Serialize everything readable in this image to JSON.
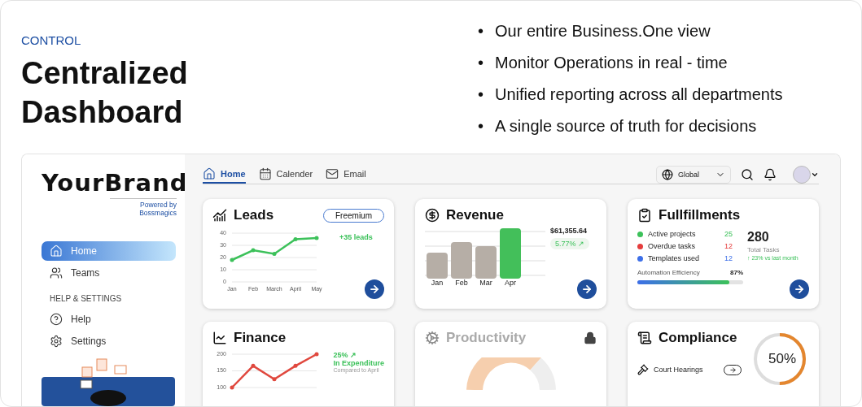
{
  "header": {
    "eyebrow": "CONTROL",
    "title": "Centralized Dashboard"
  },
  "bullets": [
    {
      "marker": "•",
      "text": "Our entire Business.One view"
    },
    {
      "marker": "•",
      "text": "Monitor Operations in real - time"
    },
    {
      "marker": "•",
      "text": "Unified reporting across all departments"
    },
    {
      "marker": "•",
      "text": "A single source of truth for decisions"
    }
  ],
  "sidebar": {
    "brand": "YourBrand",
    "tagline": "Powered by Bossmagics",
    "items": [
      {
        "label": "Home",
        "selected": true
      },
      {
        "label": "Teams",
        "selected": false
      }
    ],
    "section_label": "HELP & SETTINGS",
    "settings_items": [
      "Help",
      "Settings"
    ]
  },
  "tabs": [
    {
      "label": "Home",
      "selected": true
    },
    {
      "label": "Calender",
      "selected": false
    },
    {
      "label": "Email",
      "selected": false
    }
  ],
  "region_select": {
    "value": "Global"
  },
  "cards": [
    {
      "kind": "leads",
      "title": "Leads",
      "badge": "Freemium",
      "note": "+35 leads",
      "chart_data": {
        "type": "line",
        "categories": [
          "Jan",
          "Feb",
          "March",
          "April",
          "May"
        ],
        "series": [
          {
            "color": "#3cc15a",
            "values": [
              18,
              26,
              23,
              35,
              36
            ]
          }
        ],
        "ylim": [
          0,
          40
        ],
        "yticks": [
          0,
          10,
          20,
          30,
          40
        ],
        "grid": true
      }
    },
    {
      "kind": "revenue",
      "title": "Revenue",
      "amount": "$61,355.64",
      "change": "5.77% ↗",
      "months": [
        "Jan",
        "Feb",
        "Mar",
        "Apr"
      ]
    },
    {
      "kind": "fulfillments",
      "title": "Fullfillments",
      "stats": [
        {
          "label": "Active projects",
          "value": "25",
          "color": "#3cc15a"
        },
        {
          "label": "Overdue tasks",
          "value": "12",
          "color": "#e53d3d"
        },
        {
          "label": "Templates used",
          "value": "12",
          "color": "#3d6fe8"
        }
      ],
      "total": "280",
      "total_label": "Total Tasks",
      "trend": "↑ 23% vs last month",
      "meter": {
        "label": "Automation Efficiency",
        "reading": "87%",
        "level": 0.87
      }
    },
    {
      "kind": "finance",
      "title": "Finance",
      "change": "25% ↗",
      "change_label": "In Expenditure",
      "compare": "Compared to April",
      "chart_data": {
        "type": "line",
        "series": [
          {
            "color": "#e0483e",
            "values": [
              100,
              165,
              125,
              165,
              200
            ]
          }
        ],
        "ylim": [
          100,
          200
        ],
        "yticks": [
          100,
          150,
          200
        ],
        "grid": true
      }
    },
    {
      "kind": "productivity",
      "title": "Productivity",
      "locked": true
    },
    {
      "kind": "compliance",
      "title": "Compliance",
      "items": [
        "Court Hearings"
      ],
      "ring": {
        "reading": "50%",
        "level": 0.5
      }
    }
  ]
}
